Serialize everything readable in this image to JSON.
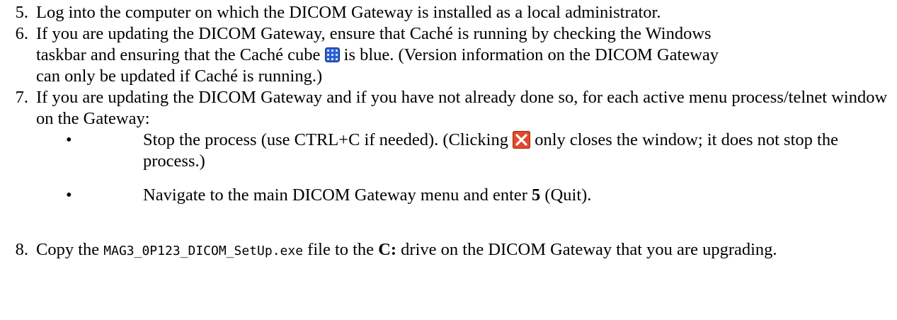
{
  "steps": [
    {
      "num": "5.",
      "text": "Log into the computer on which the DICOM Gateway is installed as a local administrator."
    },
    {
      "num": "6.",
      "text_before_icon": "If you are updating the DICOM Gateway, ensure that Caché is running by checking the Windows taskbar and ensuring that the Caché cube",
      "text_after_icon": "is blue. (Version information on the DICOM Gateway can only be updated if Caché is running.)",
      "icon": "cache-cube-icon"
    },
    {
      "num": "7.",
      "text": "If you are updating the DICOM Gateway and if you have not already done so, for each active menu process/telnet window on the Gateway:",
      "bullets": [
        {
          "symbol": "•",
          "text_before_icon": "Stop the process (use CTRL+C if needed). (Clicking",
          "text_after_icon": "only closes the window; it does not stop the process.)",
          "icon": "close-window-icon"
        },
        {
          "symbol": "•",
          "text_before_bold": "Navigate to the main DICOM Gateway menu and enter",
          "bold": "5",
          "text_after_bold": "(Quit)."
        }
      ]
    },
    {
      "num": "8.",
      "text_before_file": "Copy the",
      "file": "MAG3_0P123_DICOM_SetUp.exe",
      "text_middle": "file to the",
      "drive": "C:",
      "text_after": "drive on the DICOM Gateway that you are upgrading."
    }
  ],
  "colors": {
    "cube_blue": "#2a5fd0",
    "close_red": "#e04a2a"
  }
}
